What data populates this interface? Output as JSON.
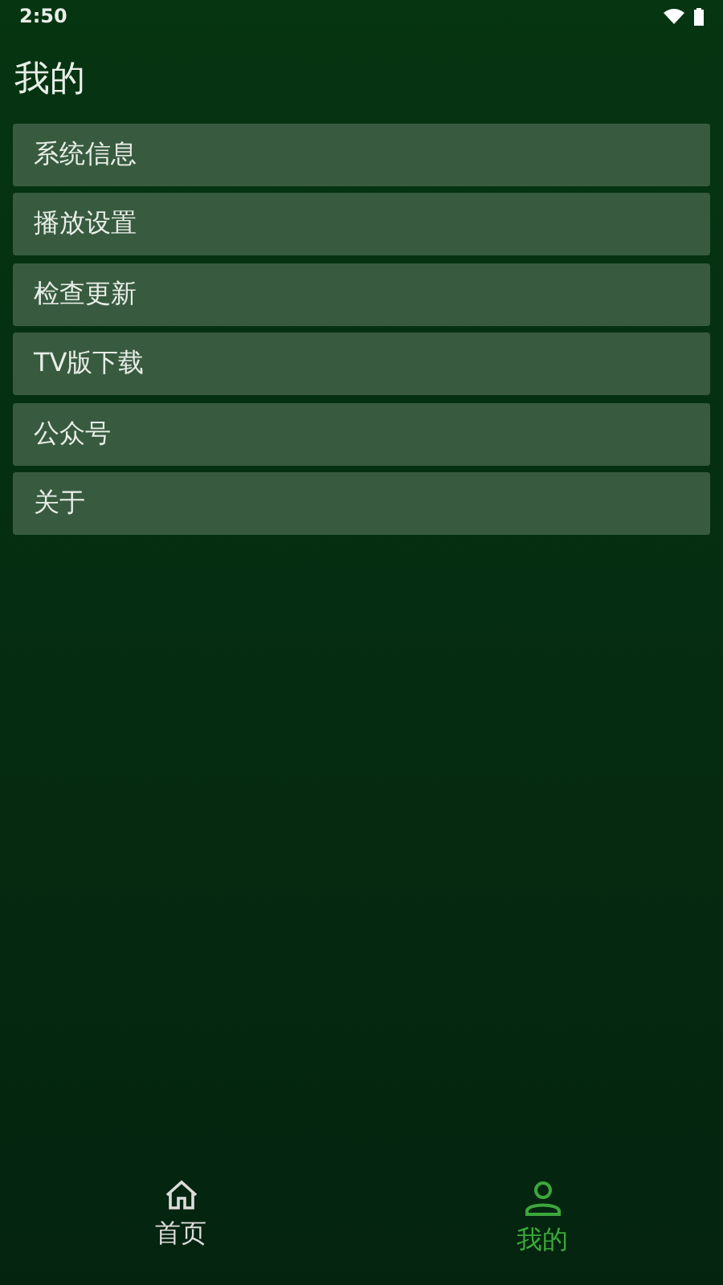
{
  "status_bar": {
    "time": "2:50"
  },
  "title": "我的",
  "menu": [
    {
      "label": "系统信息"
    },
    {
      "label": "播放设置"
    },
    {
      "label": "检查更新"
    },
    {
      "label": "TV版下载"
    },
    {
      "label": "公众号"
    },
    {
      "label": "关于"
    }
  ],
  "bottom_nav": [
    {
      "label": "首页",
      "kind": "home",
      "selected": false
    },
    {
      "label": "我的",
      "kind": "profile",
      "selected": true
    }
  ]
}
